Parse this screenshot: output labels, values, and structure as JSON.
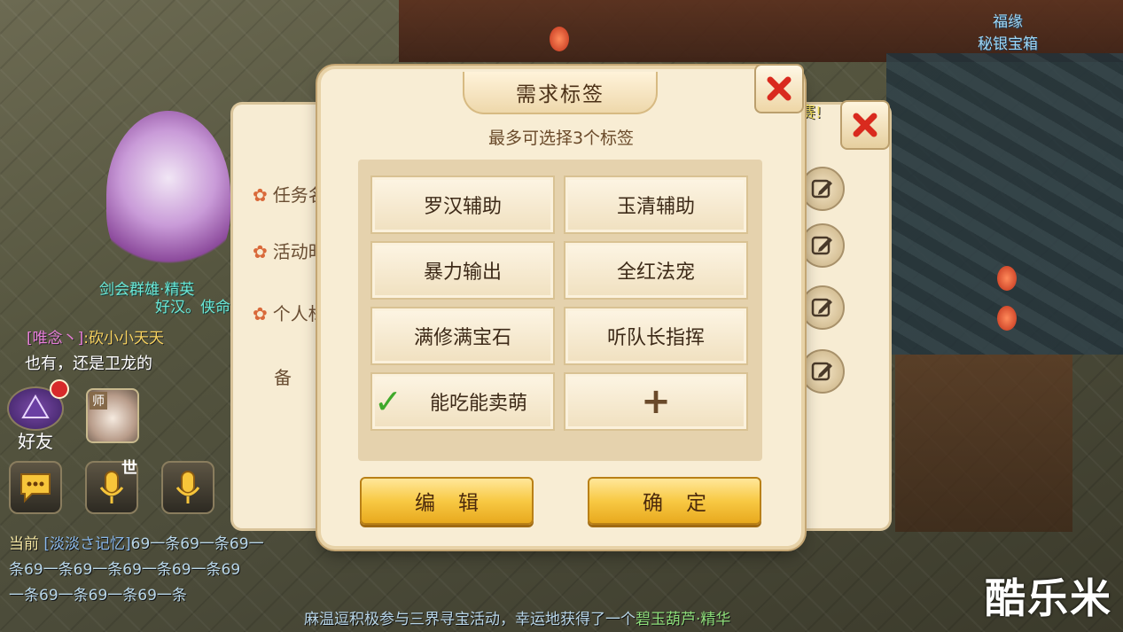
{
  "world": {
    "top_right_label_line1": "福缘",
    "top_right_label_line2": "秘银宝箱",
    "character_name": "剑会群雄·精英",
    "character_title": "好汉。侠命"
  },
  "chat": {
    "line1_prefix": "[唯念丶]",
    "line1_text": ":砍小小天天",
    "line2_text": "也有，还是卫龙的"
  },
  "side": {
    "friend_label": "好友",
    "master_tag": "师",
    "world_mic_tag": "世"
  },
  "bottom_chat": {
    "current_label": "当前",
    "sender": "[淡淡さ记忆]",
    "msg_part1": "69一条69一条69一",
    "msg_part2": "条69一条69一条69一条69一条69",
    "msg_part3": "一条69一条69一条69一条"
  },
  "system_banner": {
    "text": "麻温逗积极参与三界寻宝活动，幸运地获得了一个",
    "highlight": "碧玉葫芦·精华"
  },
  "watermark": "酷乐米",
  "background_panel": {
    "rows": [
      "任务名",
      "活动时",
      "个人标",
      "备"
    ],
    "yellow_text": "赛!"
  },
  "dialog": {
    "title": "需求标签",
    "subtitle": "最多可选择3个标签",
    "tags": [
      {
        "label": "罗汉辅助",
        "selected": false
      },
      {
        "label": "玉清辅助",
        "selected": false
      },
      {
        "label": "暴力输出",
        "selected": false
      },
      {
        "label": "全红法宠",
        "selected": false
      },
      {
        "label": "满修满宝石",
        "selected": false
      },
      {
        "label": "听队长指挥",
        "selected": false
      },
      {
        "label": "能吃能卖萌",
        "selected": true
      }
    ],
    "add_symbol": "+",
    "edit_button": "编辑",
    "confirm_button": "确定"
  }
}
